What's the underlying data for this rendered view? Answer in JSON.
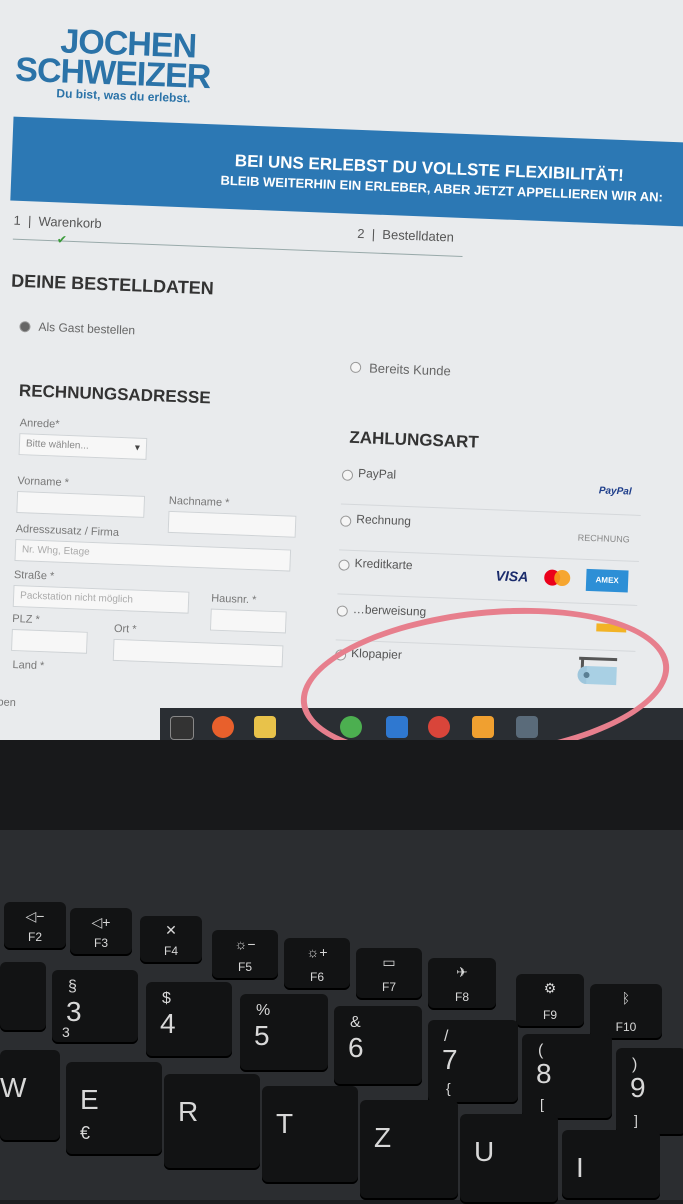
{
  "brand": {
    "line1": "JOCHEN",
    "line2": "SCHWEIZER",
    "tagline": "Du bist, was du erlebst."
  },
  "banner": {
    "line1": "BEI UNS ERLEBST DU VOLLSTE FLEXIBILITÄT!",
    "line2": "BLEIB WEITERHIN EIN ERLEBER, ABER JETZT APPELLIEREN WIR AN:"
  },
  "steps": [
    {
      "num": "1",
      "label": "Warenkorb"
    },
    {
      "num": "2",
      "label": "Bestelldaten"
    }
  ],
  "order": {
    "heading": "DEINE BESTELLDATEN",
    "guest_label": "Als Gast bestellen",
    "customer_label": "Bereits Kunde"
  },
  "billing": {
    "heading": "RECHNUNGSADRESSE",
    "anrede_label": "Anrede*",
    "anrede_value": "Bitte wählen...",
    "vorname_label": "Vorname *",
    "nachname_label": "Nachname *",
    "adresszusatz_label": "Adresszusatz / Firma",
    "adresszusatz_placeholder": "Nr. Whg, Etage",
    "strasse_label": "Straße *",
    "strasse_placeholder": "Packstation nicht möglich",
    "hausnr_label": "Hausnr. *",
    "plz_label": "PLZ *",
    "ort_label": "Ort *",
    "land_label": "Land *",
    "footer_text": "ungeben"
  },
  "payment": {
    "heading": "ZAHLUNGSART",
    "methods": [
      {
        "label": "PayPal",
        "logo": "PayPal"
      },
      {
        "label": "Rechnung",
        "logo": "RECHNUNG"
      },
      {
        "label": "Kreditkarte",
        "logo": "VISA"
      },
      {
        "label": "…berweisung",
        "logo": ""
      },
      {
        "label": "Klopapier",
        "logo": "toilet-paper-icon"
      }
    ],
    "amex_text": "AMEX"
  },
  "keyboard": {
    "fkeys": [
      "F2",
      "F3",
      "F4",
      "F5",
      "F6",
      "F7",
      "F8",
      "F9",
      "F10"
    ],
    "numbers": [
      {
        "top": "§",
        "main": "3",
        "sub": "3"
      },
      {
        "top": "$",
        "main": "4",
        "sub": ""
      },
      {
        "top": "%",
        "main": "5",
        "sub": ""
      },
      {
        "top": "&",
        "main": "6",
        "sub": ""
      },
      {
        "top": "/",
        "main": "7",
        "sub": "{"
      },
      {
        "top": "(",
        "main": "8",
        "sub": "["
      },
      {
        "top": ")",
        "main": "9",
        "sub": "]"
      }
    ],
    "letters": [
      {
        "main": "W",
        "sub": ""
      },
      {
        "main": "E",
        "sub": "€"
      },
      {
        "main": "R",
        "sub": ""
      },
      {
        "main": "T",
        "sub": ""
      },
      {
        "main": "Z",
        "sub": ""
      },
      {
        "main": "U",
        "sub": ""
      },
      {
        "main": "I",
        "sub": ""
      }
    ]
  },
  "colors": {
    "brand_blue": "#2c78b4",
    "marker": "#e77f8d"
  }
}
